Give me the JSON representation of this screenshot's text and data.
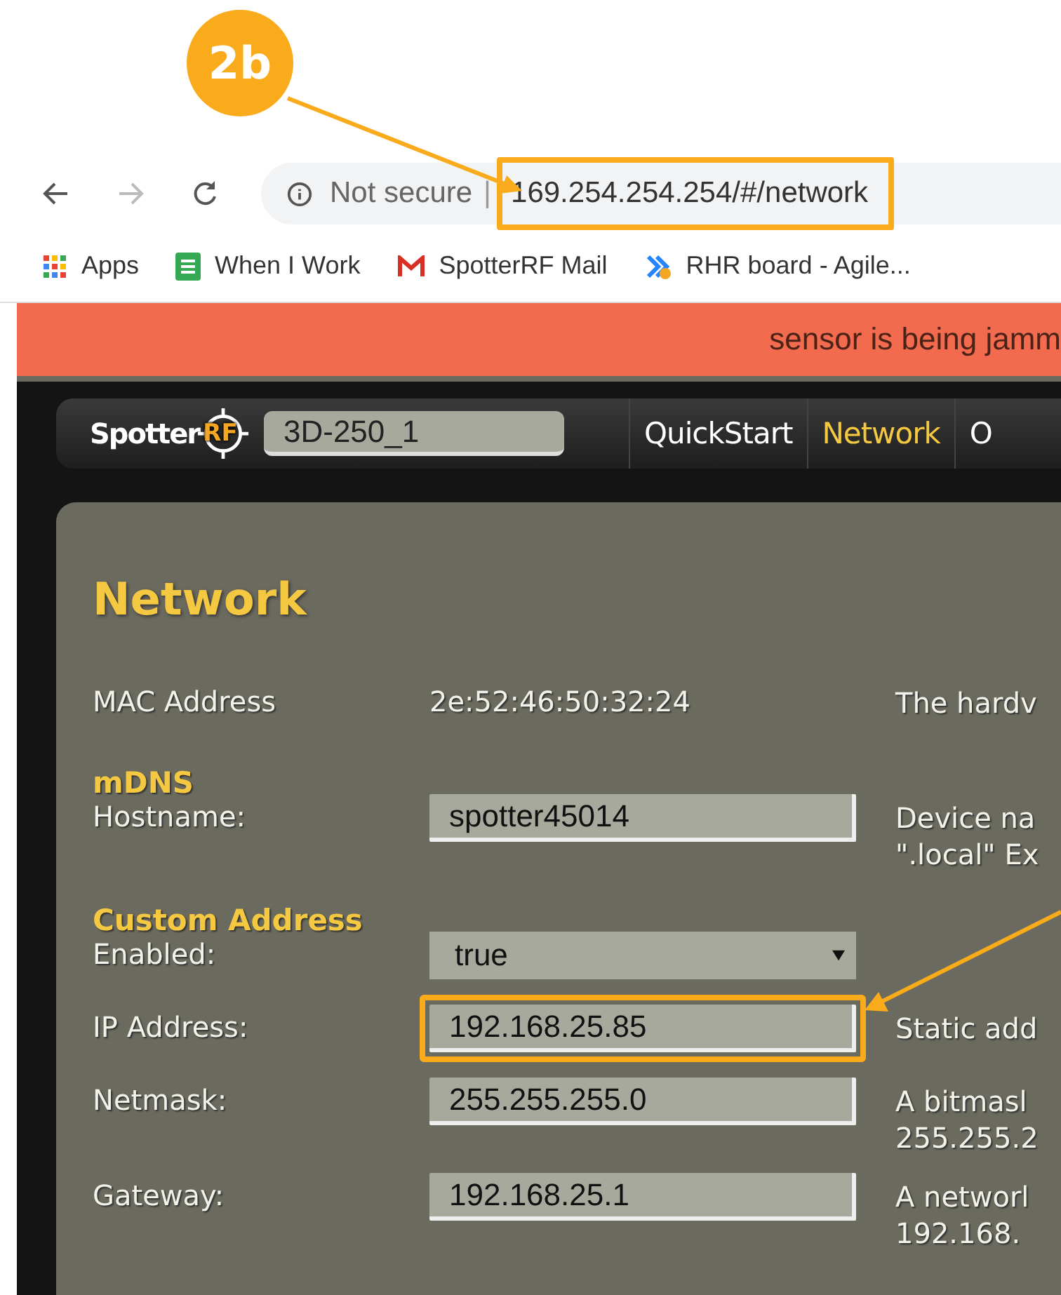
{
  "annotation": {
    "label": "2b"
  },
  "browser": {
    "security": "Not secure",
    "separator": "|",
    "url": "169.254.254.254/#/network",
    "url_highlighted": true,
    "bookmarks": [
      {
        "kind": "apps",
        "label": "Apps"
      },
      {
        "kind": "sheet",
        "label": "When I Work"
      },
      {
        "kind": "mail",
        "label": "SpotterRF Mail"
      },
      {
        "kind": "board",
        "label": "RHR board - Agile..."
      }
    ]
  },
  "banner": {
    "text": "sensor is being jamm"
  },
  "nav": {
    "logo": {
      "text": "Spotter",
      "accent": "RF"
    },
    "device_name": "3D-250_1",
    "tabs": [
      {
        "label": "QuickStart",
        "selected": false
      },
      {
        "label": "Network",
        "selected": true
      },
      {
        "label": "O",
        "selected": false
      }
    ]
  },
  "panel": {
    "title": "Network",
    "rows": [
      {
        "kind": "static",
        "label": "MAC Address",
        "value": "2e:52:46:50:32:24",
        "description": [
          "The hardv"
        ],
        "highlighted": false
      },
      {
        "kind": "section",
        "title": "mDNS"
      },
      {
        "kind": "input",
        "label": "Hostname:",
        "value": "spotter45014",
        "description": [
          "Device na",
          "\".local\" Ex"
        ],
        "highlighted": false
      },
      {
        "kind": "section",
        "title": "Custom Address"
      },
      {
        "kind": "select",
        "label": "Enabled:",
        "value": "true",
        "description": [],
        "highlighted": false
      },
      {
        "kind": "input",
        "label": "IP Address:",
        "value": "192.168.25.85",
        "description": [
          "Static add"
        ],
        "highlighted": true
      },
      {
        "kind": "input",
        "label": "Netmask:",
        "value": "255.255.255.0",
        "description": [
          "A bitmasl",
          "255.255.2"
        ],
        "highlighted": false
      },
      {
        "kind": "input",
        "label": "Gateway:",
        "value": "192.168.25.1",
        "description": [
          "A networl",
          "192.168."
        ],
        "highlighted": false
      }
    ]
  }
}
